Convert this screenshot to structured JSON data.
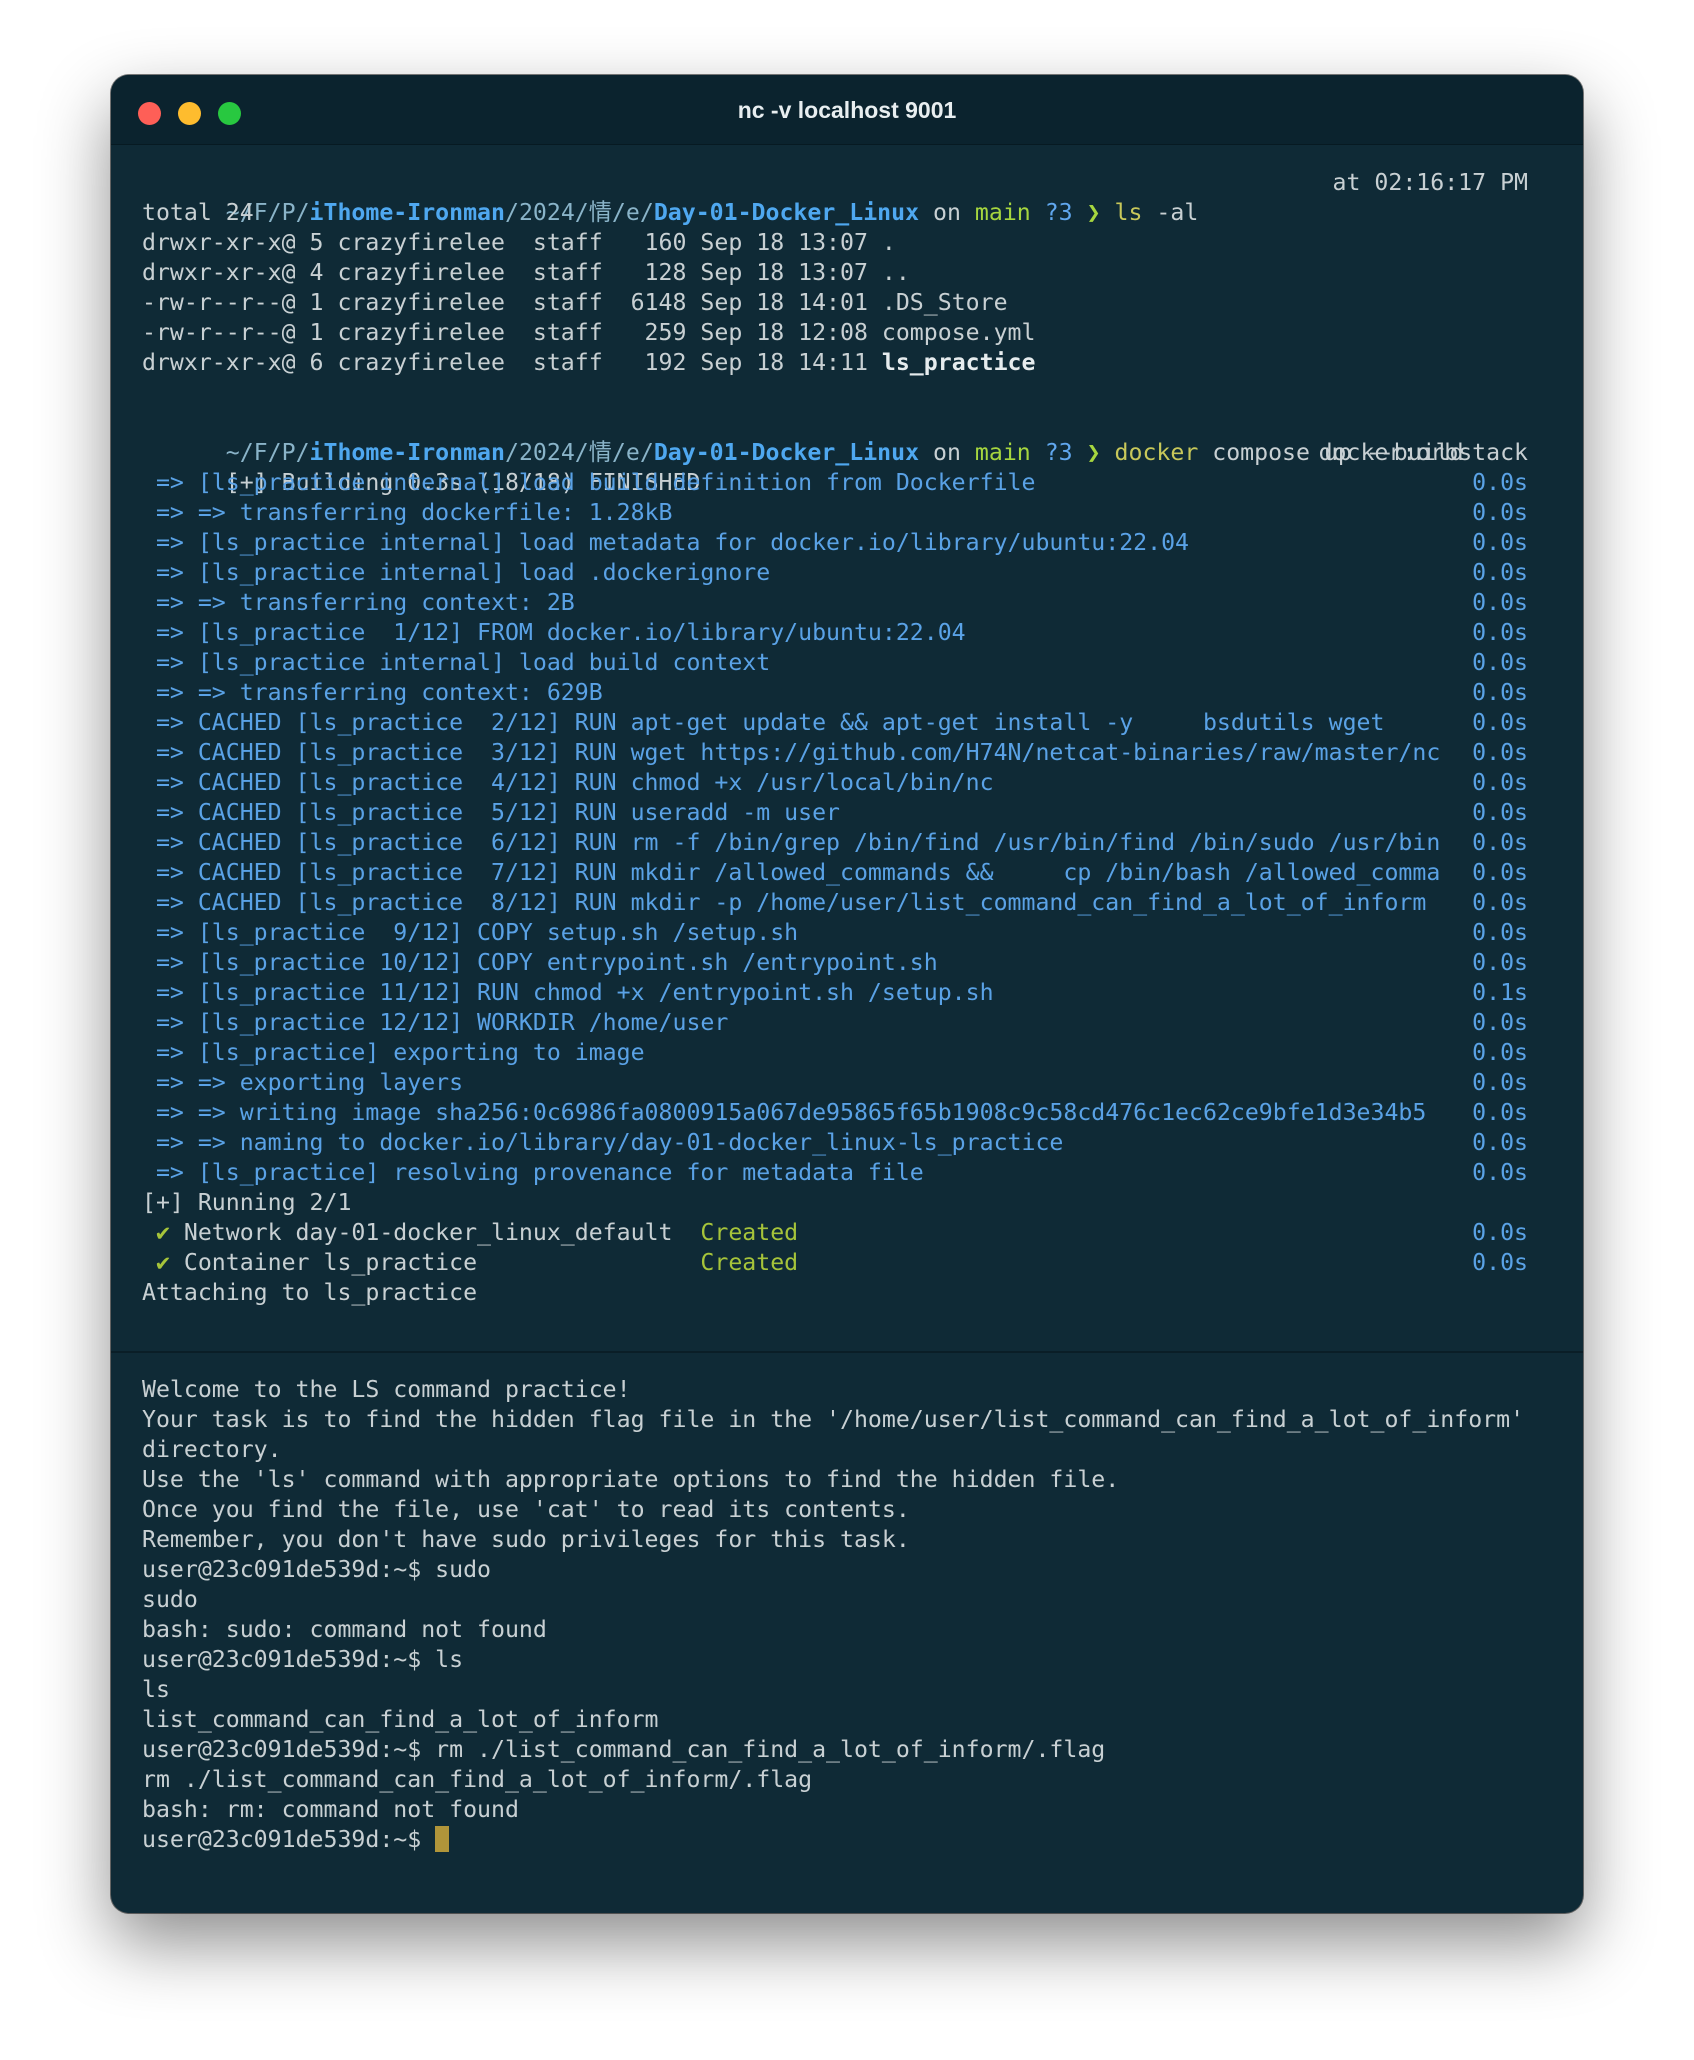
{
  "window": {
    "title": "nc -v localhost 9001"
  },
  "prompt1": {
    "path_a": "~/F/P/",
    "dir_a": "iThome-Ironman",
    "path_b": "/2024/情/e/",
    "dir_b": "Day-01-Docker_Linux",
    "on": " on ",
    "branch": "main",
    "status": " ?3",
    "arrow": " ❯ ",
    "cmd": "ls",
    "args": " -al",
    "time": "at 02:16:17 PM"
  },
  "ls_output": {
    "total": "total 24",
    "rows": [
      {
        "meta": "drwxr-xr-x@ 5 crazyfirelee  staff   160 Sep 18 13:07 ",
        "name": "."
      },
      {
        "meta": "drwxr-xr-x@ 4 crazyfirelee  staff   128 Sep 18 13:07 ",
        "name": ".."
      },
      {
        "meta": "-rw-r--r--@ 1 crazyfirelee  staff  6148 Sep 18 14:01 ",
        "name": ".DS_Store"
      },
      {
        "meta": "-rw-r--r--@ 1 crazyfirelee  staff   259 Sep 18 12:08 ",
        "name": "compose.yml"
      },
      {
        "meta": "drwxr-xr-x@ 6 crazyfirelee  staff   192 Sep 18 14:11 ",
        "name": "ls_practice"
      }
    ]
  },
  "prompt2": {
    "path_a": "~/F/P/",
    "dir_a": "iThome-Ironman",
    "path_b": "/2024/情/e/",
    "dir_b": "Day-01-Docker_Linux",
    "on": " on ",
    "branch": "main",
    "status": " ?3",
    "arrow": " ❯ ",
    "cmd": "docker",
    "args": " compose up --build"
  },
  "build": {
    "header": "[+] Building 0.3s (18/18) FINISHED",
    "context": "docker:orbstack",
    "steps": [
      {
        "text": " => [ls_practice internal] load build definition from Dockerfile",
        "time": "0.0s"
      },
      {
        "text": " => => transferring dockerfile: 1.28kB",
        "time": "0.0s"
      },
      {
        "text": " => [ls_practice internal] load metadata for docker.io/library/ubuntu:22.04",
        "time": "0.0s"
      },
      {
        "text": " => [ls_practice internal] load .dockerignore",
        "time": "0.0s"
      },
      {
        "text": " => => transferring context: 2B",
        "time": "0.0s"
      },
      {
        "text": " => [ls_practice  1/12] FROM docker.io/library/ubuntu:22.04",
        "time": "0.0s"
      },
      {
        "text": " => [ls_practice internal] load build context",
        "time": "0.0s"
      },
      {
        "text": " => => transferring context: 629B",
        "time": "0.0s"
      },
      {
        "text": " => CACHED [ls_practice  2/12] RUN apt-get update && apt-get install -y     bsdutils wget",
        "time": "0.0s"
      },
      {
        "text": " => CACHED [ls_practice  3/12] RUN wget https://github.com/H74N/netcat-binaries/raw/master/nc",
        "time": "0.0s"
      },
      {
        "text": " => CACHED [ls_practice  4/12] RUN chmod +x /usr/local/bin/nc",
        "time": "0.0s"
      },
      {
        "text": " => CACHED [ls_practice  5/12] RUN useradd -m user",
        "time": "0.0s"
      },
      {
        "text": " => CACHED [ls_practice  6/12] RUN rm -f /bin/grep /bin/find /usr/bin/find /bin/sudo /usr/bin",
        "time": "0.0s"
      },
      {
        "text": " => CACHED [ls_practice  7/12] RUN mkdir /allowed_commands &&     cp /bin/bash /allowed_comma",
        "time": "0.0s"
      },
      {
        "text": " => CACHED [ls_practice  8/12] RUN mkdir -p /home/user/list_command_can_find_a_lot_of_inform",
        "time": "0.0s"
      },
      {
        "text": " => [ls_practice  9/12] COPY setup.sh /setup.sh",
        "time": "0.0s"
      },
      {
        "text": " => [ls_practice 10/12] COPY entrypoint.sh /entrypoint.sh",
        "time": "0.0s"
      },
      {
        "text": " => [ls_practice 11/12] RUN chmod +x /entrypoint.sh /setup.sh",
        "time": "0.1s"
      },
      {
        "text": " => [ls_practice 12/12] WORKDIR /home/user",
        "time": "0.0s"
      },
      {
        "text": " => [ls_practice] exporting to image",
        "time": "0.0s"
      },
      {
        "text": " => => exporting layers",
        "time": "0.0s"
      },
      {
        "text": " => => writing image sha256:0c6986fa0800915a067de95865f65b1908c9c58cd476c1ec62ce9bfe1d3e34b5",
        "time": "0.0s"
      },
      {
        "text": " => => naming to docker.io/library/day-01-docker_linux-ls_practice",
        "time": "0.0s"
      },
      {
        "text": " => [ls_practice] resolving provenance for metadata file",
        "time": "0.0s"
      }
    ]
  },
  "running": {
    "header": "[+] Running 2/1",
    "items": [
      {
        "check": " ✔",
        "name": " Network day-01-docker_linux_default  ",
        "status": "Created",
        "time": "0.0s"
      },
      {
        "check": " ✔",
        "name": " Container ls_practice                ",
        "status": "Created",
        "time": "0.0s"
      }
    ],
    "attaching": "Attaching to ls_practice"
  },
  "session": {
    "lines": [
      "Welcome to the LS command practice!",
      "Your task is to find the hidden flag file in the '/home/user/list_command_can_find_a_lot_of_inform' directory.",
      "Use the 'ls' command with appropriate options to find the hidden file.",
      "Once you find the file, use 'cat' to read its contents.",
      "Remember, you don't have sudo privileges for this task.",
      "user@23c091de539d:~$ sudo",
      "sudo",
      "bash: sudo: command not found",
      "user@23c091de539d:~$ ls",
      "ls",
      "list_command_can_find_a_lot_of_inform",
      "user@23c091de539d:~$ rm ./list_command_can_find_a_lot_of_inform/.flag",
      "rm ./list_command_can_find_a_lot_of_inform/.flag",
      "bash: rm: command not found"
    ],
    "final_prompt": "user@23c091de539d:~$ "
  }
}
